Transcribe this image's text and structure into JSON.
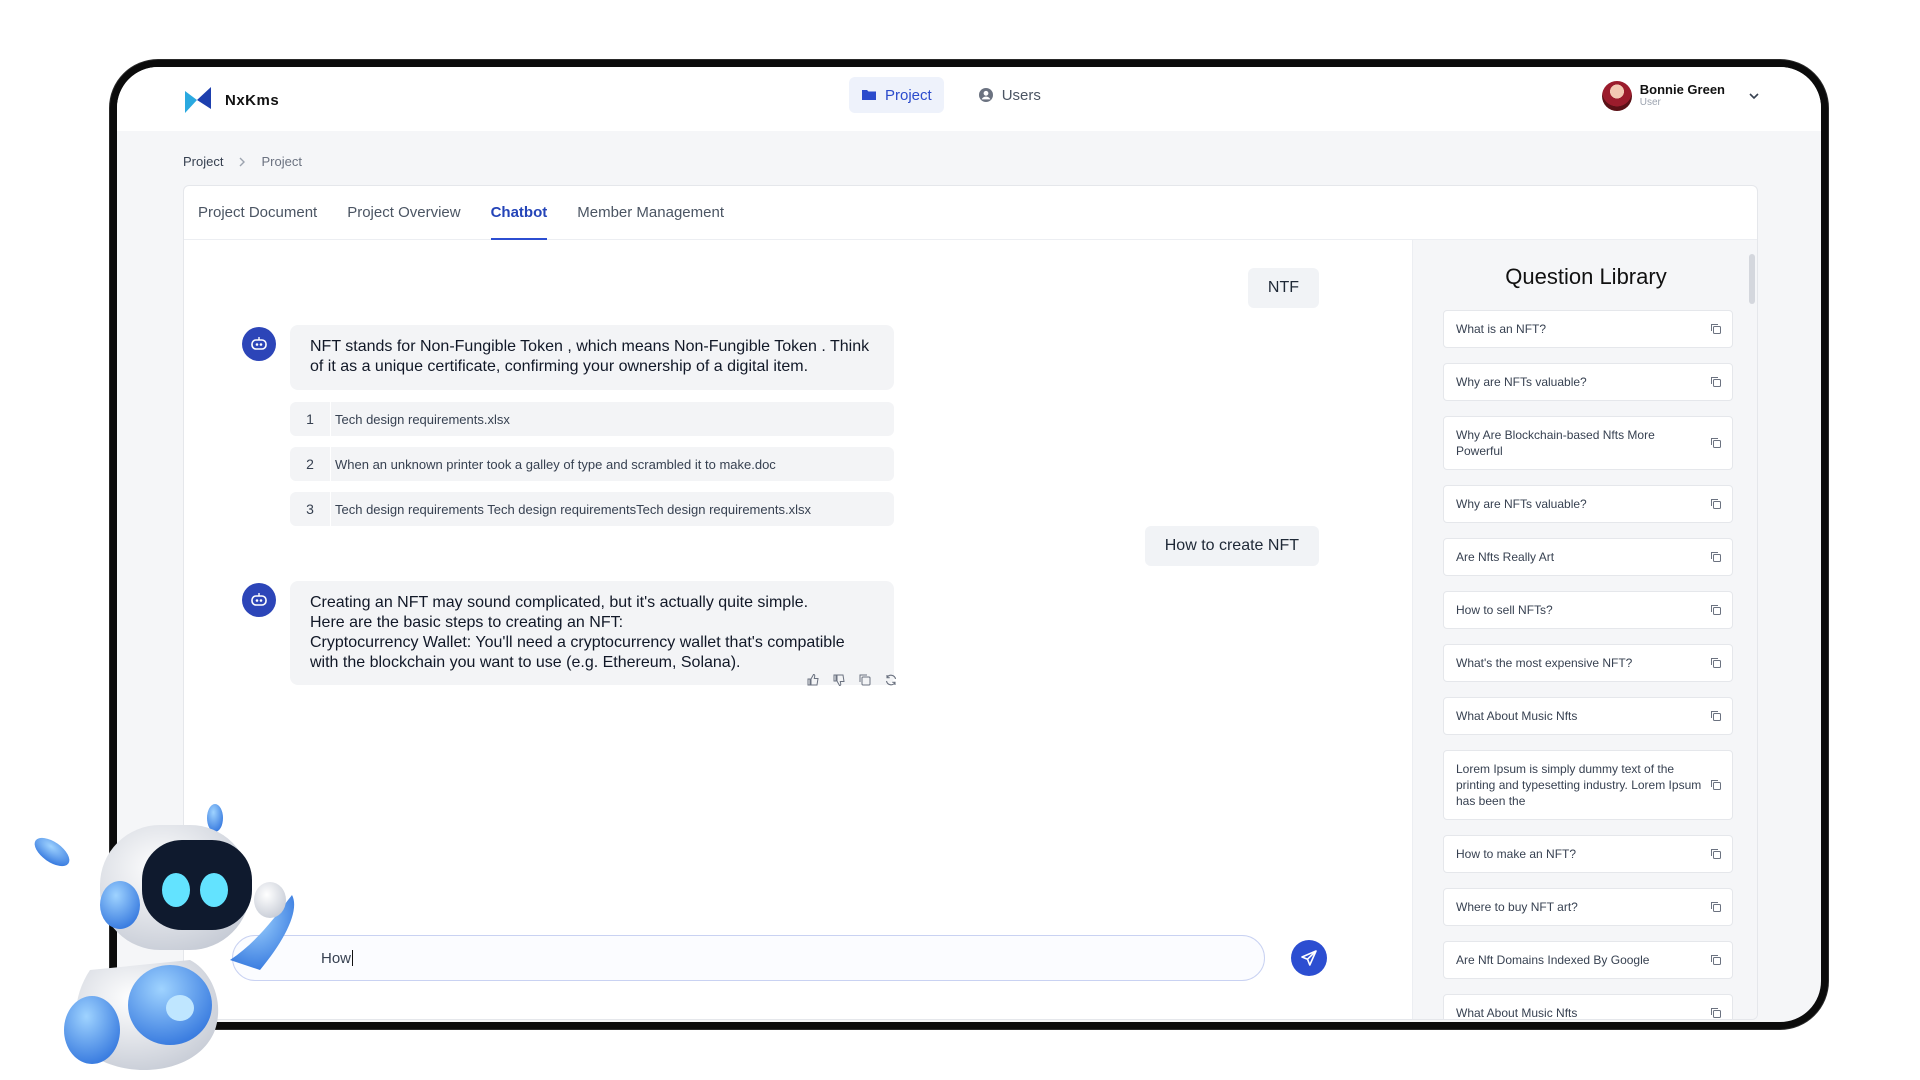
{
  "app": {
    "name": "NxKms"
  },
  "nav": {
    "tabs": [
      {
        "label": "Project",
        "icon": "folder-icon",
        "active": true
      },
      {
        "label": "Users",
        "icon": "user-circle-icon",
        "active": false
      }
    ]
  },
  "user": {
    "name": "Bonnie Green",
    "role": "User"
  },
  "breadcrumb": [
    "Project",
    "Project"
  ],
  "tabs": [
    {
      "label": "Project Document",
      "active": false
    },
    {
      "label": "Project Overview",
      "active": false
    },
    {
      "label": "Chatbot",
      "active": true
    },
    {
      "label": "Member Management",
      "active": false
    }
  ],
  "chat": {
    "messages": [
      {
        "role": "user",
        "text": "NTF"
      },
      {
        "role": "bot",
        "text": "NFT stands for Non-Fungible Token , which means Non-Fungible Token . Think of it as a unique certificate, confirming your ownership of a digital item.",
        "references": [
          {
            "num": "1",
            "name": "Tech design requirements.xlsx"
          },
          {
            "num": "2",
            "name": "When an unknown printer took a galley of type and scrambled it to make.doc"
          },
          {
            "num": "3",
            "name": "Tech design requirements Tech design requirementsTech design requirements.xlsx"
          }
        ]
      },
      {
        "role": "user",
        "text": "How to create NFT"
      },
      {
        "role": "bot",
        "text": "Creating an NFT may sound complicated, but it's actually quite simple.\nHere are the basic steps to creating an NFT:\nCryptocurrency Wallet: You'll need a cryptocurrency wallet that's compatible with the blockchain you want to use (e.g. Ethereum, Solana)."
      }
    ],
    "composer_value": "How",
    "actions": [
      "thumbs-up-icon",
      "thumbs-down-icon",
      "copy-icon",
      "refresh-icon"
    ]
  },
  "question_library": {
    "title": "Question Library",
    "items": [
      "What is an NFT?",
      "Why are NFTs valuable?",
      "Why Are Blockchain-based Nfts More Powerful",
      "Why are NFTs valuable?",
      "Are Nfts Really Art",
      "How to sell NFTs?",
      "What's the most expensive NFT?",
      "What About Music Nfts",
      "Lorem Ipsum is simply dummy text of the printing and typesetting industry. Lorem Ipsum has been the",
      "How to make an NFT?",
      "Where to buy NFT art?",
      "Are Nft Domains Indexed By Google",
      "What About Music Nfts"
    ]
  },
  "colors": {
    "accent": "#2c4ed1",
    "bot_icon": "#2c45b8",
    "frame": "#0b0b0b"
  }
}
